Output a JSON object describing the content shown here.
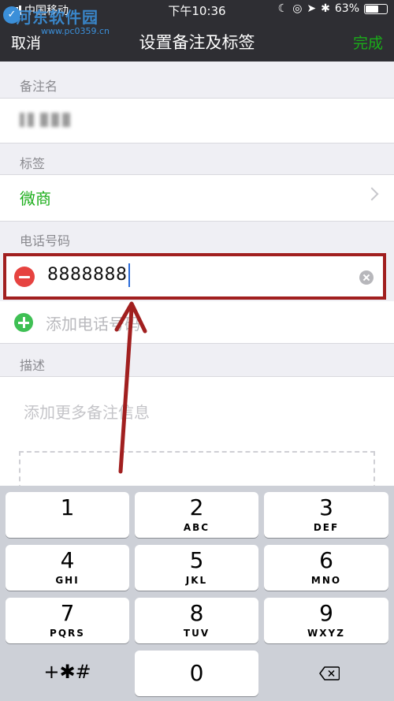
{
  "status_bar": {
    "carrier": "中国移动",
    "time": "下午10:36",
    "battery": "63%",
    "battery_level": 0.63
  },
  "watermark": {
    "text": "河东软件园",
    "url": "www.pc0359.cn"
  },
  "nav": {
    "cancel_label": "取消",
    "title": "设置备注及标签",
    "done_label": "完成"
  },
  "remark": {
    "section_label": "备注名"
  },
  "tags": {
    "section_label": "标签",
    "value": "微商"
  },
  "phone": {
    "section_label": "电话号码",
    "value": "8888888",
    "add_label": "添加电话号码"
  },
  "description": {
    "section_label": "描述",
    "placeholder": "添加更多备注信息"
  },
  "keypad": {
    "keys": [
      {
        "num": "1",
        "letters": ""
      },
      {
        "num": "2",
        "letters": "ABC"
      },
      {
        "num": "3",
        "letters": "DEF"
      },
      {
        "num": "4",
        "letters": "GHI"
      },
      {
        "num": "5",
        "letters": "JKL"
      },
      {
        "num": "6",
        "letters": "MNO"
      },
      {
        "num": "7",
        "letters": "PQRS"
      },
      {
        "num": "8",
        "letters": "TUV"
      },
      {
        "num": "9",
        "letters": "WXYZ"
      }
    ],
    "symbols_label": "+✱#",
    "zero": "0"
  },
  "colors": {
    "accent_green": "#1aad19",
    "highlight_red": "#a11f1f",
    "nav_bg": "#2e2e33"
  }
}
